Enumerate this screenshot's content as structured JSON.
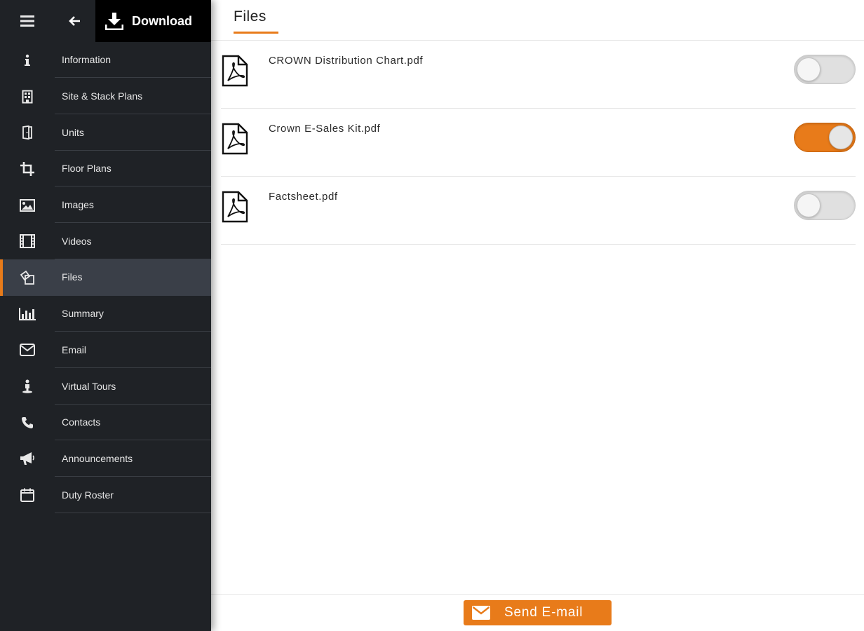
{
  "topbar": {
    "menu_icon": "hamburger-icon",
    "back_icon": "arrow-left-icon",
    "download_label": "Download",
    "download_icon": "download-icon"
  },
  "sidebar": {
    "items": [
      {
        "label": "Information",
        "icon": "info-icon"
      },
      {
        "label": "Site & Stack Plans",
        "icon": "building-icon"
      },
      {
        "label": "Units",
        "icon": "door-icon"
      },
      {
        "label": "Floor Plans",
        "icon": "crop-icon"
      },
      {
        "label": "Images",
        "icon": "image-icon"
      },
      {
        "label": "Videos",
        "icon": "film-icon"
      },
      {
        "label": "Files",
        "icon": "files-icon",
        "active": true
      },
      {
        "label": "Summary",
        "icon": "bar-chart-icon"
      },
      {
        "label": "Email",
        "icon": "envelope-icon"
      },
      {
        "label": "Virtual Tours",
        "icon": "person-pin-icon"
      },
      {
        "label": "Contacts",
        "icon": "phone-icon"
      },
      {
        "label": "Announcements",
        "icon": "megaphone-icon"
      },
      {
        "label": "Duty Roster",
        "icon": "calendar-icon"
      }
    ]
  },
  "main": {
    "tab_title": "Files",
    "files": [
      {
        "name": "CROWN Distribution Chart.pdf",
        "selected": false
      },
      {
        "name": "Crown E-Sales Kit.pdf",
        "selected": true
      },
      {
        "name": "Factsheet.pdf",
        "selected": false
      }
    ],
    "send_button_label": "Send E-mail"
  },
  "colors": {
    "accent": "#e87b1a",
    "sidebar_bg": "#1f2226",
    "active_item_bg": "#3a3f48"
  }
}
